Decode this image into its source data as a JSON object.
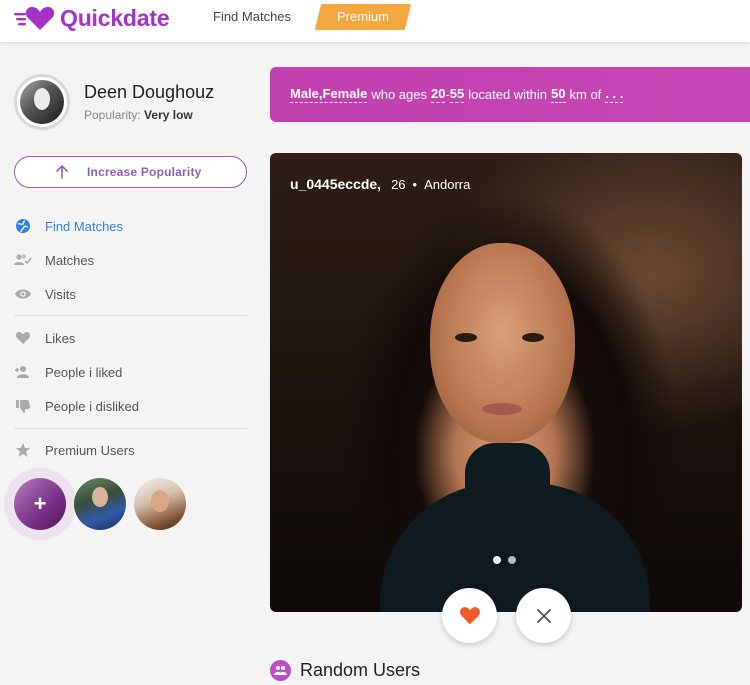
{
  "header": {
    "logo_text": "Quickdate",
    "nav_find_matches": "Find Matches",
    "premium_label": "Premium",
    "brand_color": "#a333c8",
    "premium_color": "#f2a83e"
  },
  "profile": {
    "name": "Deen Doughouz",
    "popularity_label": "Popularity:",
    "popularity_value": "Very low"
  },
  "increase_popularity": {
    "label": "Increase Popularity",
    "icon": "arrow-up-icon"
  },
  "sidebar": {
    "items": [
      {
        "label": "Find Matches",
        "icon": "globe-icon",
        "active": true
      },
      {
        "label": "Matches",
        "icon": "users-check-icon"
      },
      {
        "label": "Visits",
        "icon": "eye-icon"
      },
      {
        "label": "Likes",
        "icon": "heart-icon"
      },
      {
        "label": "People i liked",
        "icon": "user-add-icon"
      },
      {
        "label": "People i disliked",
        "icon": "thumbs-down-icon"
      },
      {
        "label": "Premium Users",
        "icon": "star-icon"
      }
    ],
    "active_color": "#2f80ed"
  },
  "premium_users": {
    "add_symbol": "+"
  },
  "filter": {
    "gender": "Male,Female",
    "who_ages": "who ages",
    "age_min": "20",
    "dash": "-",
    "age_max": "55",
    "located_within": "located within",
    "distance": "50",
    "km_of": "km of",
    "location": ". . ."
  },
  "card": {
    "username": "u_0445eccde,",
    "age": "26",
    "separator": "•",
    "country": "Andorra",
    "photo_count": 2
  },
  "actions": {
    "like_icon": "heart-icon",
    "dislike_icon": "close-icon",
    "like_color": "#f05a28"
  },
  "random_users": {
    "title": "Random Users"
  }
}
